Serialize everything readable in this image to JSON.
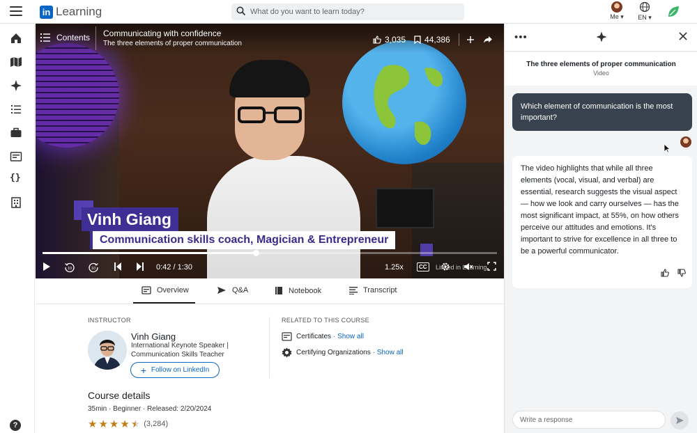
{
  "header": {
    "logo_mark": "in",
    "logo_text": "Learning",
    "search_placeholder": "What do you want to learn today?",
    "me_label": "Me ▾",
    "lang_label": "EN ▾"
  },
  "video": {
    "contents_label": "Contents",
    "title": "Communicating with confidence",
    "subtitle": "The three elements of proper communication",
    "likes": "3,035",
    "saves": "44,386",
    "lower_third_name": "Vinh Giang",
    "lower_third_role": "Communication skills coach, Magician & Entrepreneur",
    "time": "0:42 / 1:30",
    "progress": 0.47,
    "speed": "1.25x",
    "cc_label": "CC",
    "watermark": "Linked in Learning"
  },
  "tabs": [
    {
      "label": "Overview",
      "icon": "overview-icon",
      "active": true
    },
    {
      "label": "Q&A",
      "icon": "send-icon",
      "active": false
    },
    {
      "label": "Notebook",
      "icon": "notebook-icon",
      "active": false
    },
    {
      "label": "Transcript",
      "icon": "transcript-icon",
      "active": false
    }
  ],
  "instructor": {
    "section_label": "INSTRUCTOR",
    "name": "Vinh Giang",
    "title": "International Keynote Speaker | Communication Skills Teacher",
    "follow_label": "Follow on LinkedIn"
  },
  "related": {
    "section_label": "RELATED TO THIS COURSE",
    "certificates_label": "Certificates",
    "certificates_show": "· Show all",
    "orgs_label": "Certifying Organizations",
    "orgs_show": "· Show all"
  },
  "course": {
    "details_title": "Course details",
    "meta": "35min  ·  Beginner  ·  Released: 2/20/2024",
    "rating": 4.5,
    "rating_count": "(3,284)"
  },
  "panel": {
    "context_title": "The three elements of proper communication",
    "context_sub": "Video",
    "question": "Which element of communication is the most important?",
    "answer": "The video highlights that while all three elements (vocal, visual, and verbal) are essential, research suggests the visual aspect — how we look and carry ourselves — has the most significant impact, at 55%, on how others perceive our attitudes and emotions. It's important to strive for excellence in all three to be a powerful communicator.",
    "reply_placeholder": "Write a response"
  },
  "colors": {
    "brand": "#0a66c2",
    "question_bubble": "#38434f",
    "star": "#c37d16",
    "lower_third": "#3f2f95"
  }
}
